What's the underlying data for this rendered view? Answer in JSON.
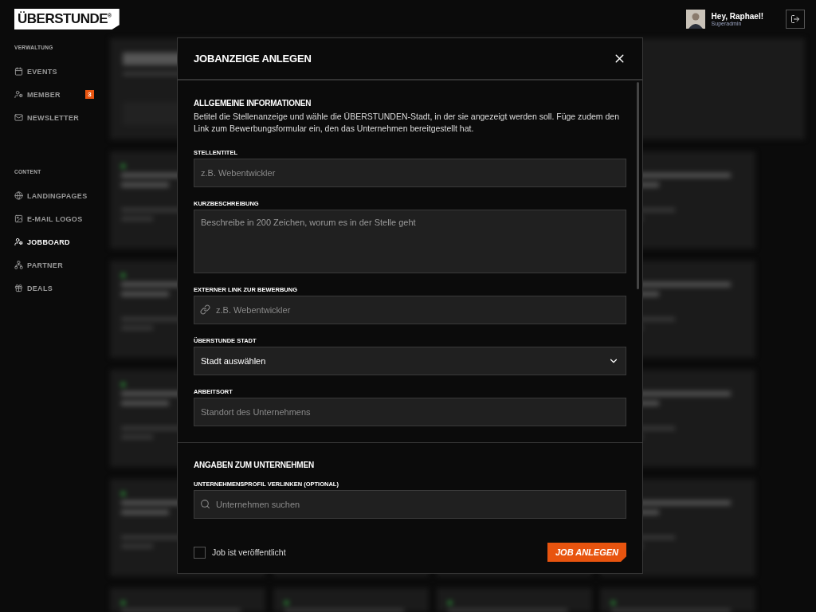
{
  "logo": {
    "text": "ÜBERSTUNDE$^{®}$"
  },
  "user": {
    "greeting": "Hey, Raphael!",
    "role": "Superadmin"
  },
  "sidebar": [
    {
      "title": "VERWALTUNG",
      "items": [
        {
          "label": "EVENTS",
          "selected": false
        },
        {
          "label": "MEMBER",
          "selected": false,
          "badge": "3"
        },
        {
          "label": "NEWSLETTER",
          "selected": false
        }
      ]
    },
    {
      "title": "CONTENT",
      "items": [
        {
          "label": "LANDINGPAGES",
          "selected": false
        },
        {
          "label": "E-MAIL LOGOS",
          "selected": false
        },
        {
          "label": "JOBBOARD",
          "selected": true
        },
        {
          "label": "PARTNER",
          "selected": false
        },
        {
          "label": "DEALS",
          "selected": false
        }
      ]
    }
  ],
  "modal": {
    "title": "JOBANZEIGE ANLEGEN",
    "sections": [
      {
        "title": "ALLGEMEINE INFORMATIONEN",
        "description": "Betitel die Stellenanzeige und wähle die ÜBERSTUNDEN-Stadt, in der sie angezeigt werden soll. Füge zudem den Link zum Bewerbungsformular ein, den das Unternehmen bereitgestellt hat.",
        "fields": [
          {
            "label": "STELLENTITEL",
            "kind": "text",
            "placeholder": "z.B. Webentwickler"
          },
          {
            "label": "KURZBESCHREIBUNG",
            "kind": "textarea",
            "placeholder": "Beschreibe in 200 Zeichen, worum es in der Stelle geht"
          },
          {
            "label": "EXTERNER LINK ZUR BEWERBUNG",
            "kind": "link",
            "placeholder": "z.B. Webentwickler"
          },
          {
            "label": "ÜBERSTUNDE STADT",
            "kind": "select",
            "value": "Stadt auswählen"
          },
          {
            "label": "ARBEITSORT",
            "kind": "text",
            "placeholder": "Standort des Unternehmens"
          }
        ]
      },
      {
        "title": "ANGABEN ZUM UNTERNEHMEN",
        "fields": [
          {
            "label": "UNTERNEHMENSPROFIL VERLINKEN (OPTIONAL)",
            "kind": "search",
            "placeholder": "Unternehmen suchen"
          }
        ]
      }
    ],
    "published": {
      "label": "Job ist veröffentlicht",
      "checked": false
    },
    "submit": "JOB ANLEGEN"
  }
}
